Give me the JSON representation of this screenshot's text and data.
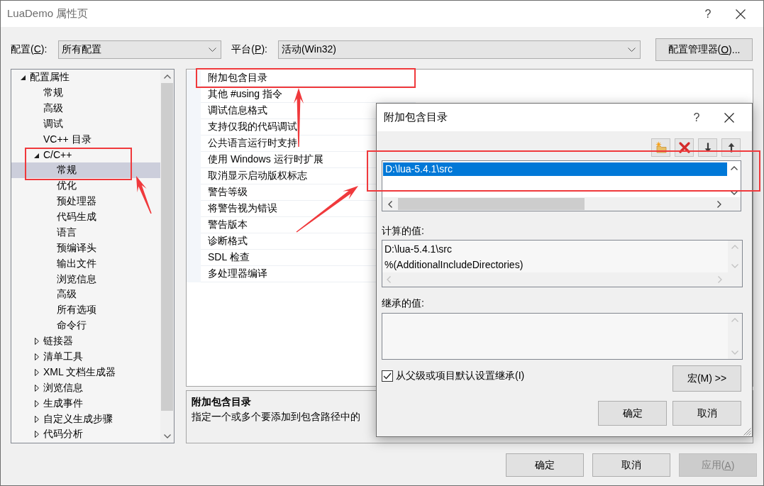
{
  "window": {
    "title": "LuaDemo 属性页",
    "help": "?"
  },
  "config_bar": {
    "configuration": {
      "label": {
        "pre": "配置(",
        "key": "C",
        "post": "):"
      },
      "value": "所有配置"
    },
    "platform": {
      "label": {
        "pre": "平台(",
        "key": "P",
        "post": "):"
      },
      "value": "活动(Win32)"
    },
    "manager_button": {
      "label": {
        "pre": "配置管理器(",
        "key": "O",
        "post": ")..."
      }
    }
  },
  "tree": {
    "items": [
      {
        "label": "配置属性",
        "expanded": true,
        "selected": false,
        "marked": false,
        "children": [
          {
            "label": "常规",
            "selected": false,
            "marked": false
          },
          {
            "label": "高级",
            "selected": false,
            "marked": false
          },
          {
            "label": "调试",
            "selected": false,
            "marked": false
          },
          {
            "label": "VC++ 目录",
            "selected": false,
            "marked": false
          },
          {
            "label": "C/C++",
            "expanded": true,
            "selected": false,
            "marked": true,
            "children": [
              {
                "label": "常规",
                "selected": true,
                "marked": false
              },
              {
                "label": "优化",
                "selected": false,
                "marked": false
              },
              {
                "label": "预处理器",
                "selected": false,
                "marked": false
              },
              {
                "label": "代码生成",
                "selected": false,
                "marked": false
              },
              {
                "label": "语言",
                "selected": false,
                "marked": false
              },
              {
                "label": "预编译头",
                "selected": false,
                "marked": false
              },
              {
                "label": "输出文件",
                "selected": false,
                "marked": false
              },
              {
                "label": "浏览信息",
                "selected": false,
                "marked": false
              },
              {
                "label": "高级",
                "selected": false,
                "marked": false
              },
              {
                "label": "所有选项",
                "selected": false,
                "marked": false
              },
              {
                "label": "命令行",
                "selected": false,
                "marked": false
              }
            ]
          },
          {
            "label": "链接器",
            "expanded": false,
            "selected": false,
            "marked": false
          },
          {
            "label": "清单工具",
            "expanded": false,
            "selected": false,
            "marked": false
          },
          {
            "label": "XML 文档生成器",
            "expanded": false,
            "selected": false,
            "marked": false
          },
          {
            "label": "浏览信息",
            "expanded": false,
            "selected": false,
            "marked": false
          },
          {
            "label": "生成事件",
            "expanded": false,
            "selected": false,
            "marked": false
          },
          {
            "label": "自定义生成步骤",
            "expanded": false,
            "selected": false,
            "marked": false
          },
          {
            "label": "代码分析",
            "expanded": false,
            "selected": false,
            "marked": false
          }
        ]
      }
    ]
  },
  "properties": {
    "rows": [
      {
        "name": "附加包含目录",
        "marked": true
      },
      {
        "name": "其他 #using 指令",
        "marked": false
      },
      {
        "name": "调试信息格式",
        "marked": false
      },
      {
        "name": "支持仅我的代码调试",
        "marked": false
      },
      {
        "name": "公共语言运行时支持",
        "marked": false
      },
      {
        "name": "使用 Windows 运行时扩展",
        "marked": false
      },
      {
        "name": "取消显示启动版权标志",
        "marked": false
      },
      {
        "name": "警告等级",
        "marked": false
      },
      {
        "name": "将警告视为错误",
        "marked": false
      },
      {
        "name": "警告版本",
        "marked": false
      },
      {
        "name": "诊断格式",
        "marked": false
      },
      {
        "name": "SDL 检查",
        "marked": false
      },
      {
        "name": "多处理器编译",
        "marked": false
      }
    ]
  },
  "description": {
    "title": "附加包含目录",
    "text": "指定一个或多个要添加到包含路径中的"
  },
  "buttons": [
    {
      "label": "确定",
      "disabled": false
    },
    {
      "label": "取消",
      "disabled": false
    },
    {
      "label": {
        "pre": "应用(",
        "key": "A",
        "post": ")"
      },
      "disabled": true
    }
  ],
  "dialog": {
    "title": "附加包含目录",
    "help": "?",
    "toolbar": [
      {
        "kind": "new_folder"
      },
      {
        "kind": "delete"
      },
      {
        "kind": "move_down"
      },
      {
        "kind": "move_up"
      }
    ],
    "directories": {
      "marked": true,
      "items": [
        {
          "text": "D:\\lua-5.4.1\\src",
          "selected": true
        }
      ]
    },
    "computed": {
      "label": "计算的值:",
      "lines": [
        "D:\\lua-5.4.1\\src",
        "%(AdditionalIncludeDirectories)"
      ]
    },
    "inherited": {
      "label": "继承的值:"
    },
    "inherit_checkbox": {
      "label": "从父级或项目默认设置继承(I)",
      "checked": true
    },
    "macro_button": "宏(M) >>",
    "buttons": [
      "确定",
      "取消"
    ]
  }
}
